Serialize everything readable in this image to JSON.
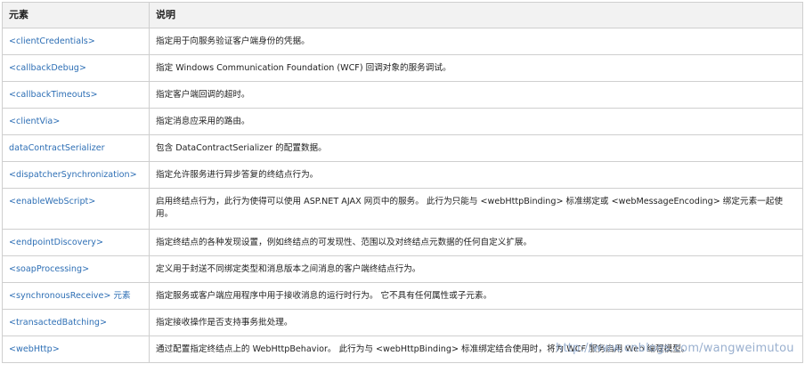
{
  "table": {
    "headers": [
      "元素",
      "说明"
    ],
    "rows": [
      {
        "element": "<clientCredentials>",
        "desc": "指定用于向服务验证客户端身份的凭据。"
      },
      {
        "element": "<callbackDebug>",
        "desc": "指定 Windows Communication Foundation (WCF) 回调对象的服务调试。"
      },
      {
        "element": "<callbackTimeouts>",
        "desc": "指定客户端回调的超时。"
      },
      {
        "element": "<clientVia>",
        "desc": "指定消息应采用的路由。"
      },
      {
        "element": "dataContractSerializer",
        "desc": "包含 DataContractSerializer 的配置数据。"
      },
      {
        "element": "<dispatcherSynchronization>",
        "desc": "指定允许服务进行异步答复的终结点行为。"
      },
      {
        "element": "<enableWebScript>",
        "desc": "启用终结点行为，此行为使得可以使用 ASP.NET AJAX 网页中的服务。 此行为只能与 <webHttpBinding> 标准绑定或 <webMessageEncoding> 绑定元素一起使用。"
      },
      {
        "element": "<endpointDiscovery>",
        "desc": "指定终结点的各种发现设置，例如终结点的可发现性、范围以及对终结点元数据的任何自定义扩展。"
      },
      {
        "element": "<soapProcessing>",
        "desc": "定义用于封送不同绑定类型和消息版本之间消息的客户端终结点行为。"
      },
      {
        "element": "<synchronousReceive> 元素",
        "desc": "指定服务或客户端应用程序中用于接收消息的运行时行为。 它不具有任何属性或子元素。"
      },
      {
        "element": "<transactedBatching>",
        "desc": "指定接收操作是否支持事务批处理。"
      },
      {
        "element": "<webHttp>",
        "desc": "通过配置指定终结点上的 WebHttpBehavior。 此行为与 <webHttpBinding> 标准绑定结合使用时，将为 WCF 服务启用 Web 编程模型。"
      }
    ]
  },
  "watermark": "http://www.cnblogs.com/wangweimutou",
  "colors": {
    "link": "#2e6fb5",
    "header_bg": "#f2f2f2",
    "border": "#cfcfcf"
  }
}
